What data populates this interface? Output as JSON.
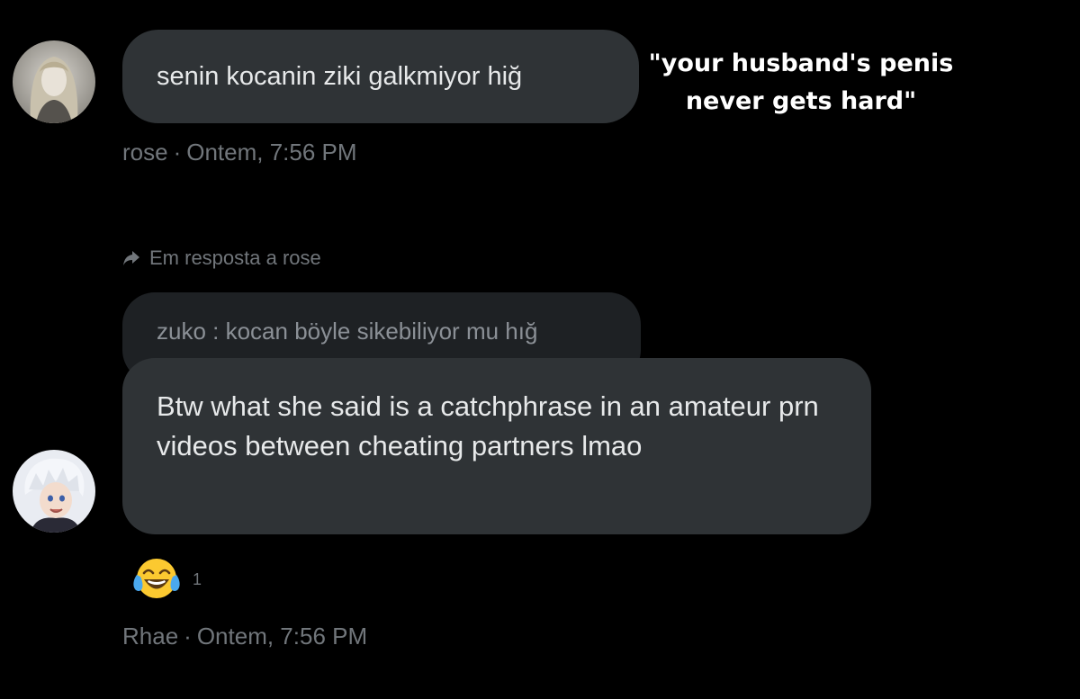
{
  "messages": [
    {
      "sender": "rose",
      "text": "senin kocanin ziki galkmiyor hiğ",
      "timestamp": "Ontem, 7:56 PM",
      "avatar": "blonde-woman-avatar"
    }
  ],
  "reply": {
    "context_label": "Em resposta a rose",
    "quoted_text": "zuko : kocan böyle sikebiliyor mu hığ",
    "sender": "Rhae",
    "text": "Btw what she said is a catchphrase in an amateur prn videos between cheating partners lmao",
    "timestamp": "Ontem, 7:56 PM",
    "avatar": "white-hair-anime-avatar",
    "reaction": {
      "emoji": "😂",
      "icon": "tears-of-joy-emoji-icon",
      "count": "1"
    }
  },
  "caption": {
    "line1": "\"your husband's penis",
    "line2": "never gets hard\""
  },
  "colors": {
    "background": "#000000",
    "bubble": "#2f3336",
    "quoted_bubble": "#1e2124",
    "text": "#e7e9ea",
    "muted": "#71767b",
    "caption": "#ffffff"
  }
}
